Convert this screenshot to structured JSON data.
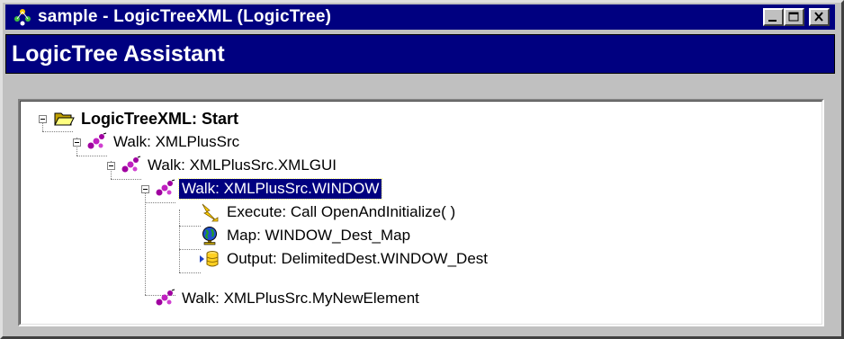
{
  "window": {
    "title": "sample - LogicTreeXML (LogicTree)",
    "controls": [
      "minimize",
      "maximize",
      "close"
    ]
  },
  "banner": {
    "title": "LogicTree Assistant"
  },
  "tree": {
    "nodes": [
      {
        "label": "LogicTreeXML: Start",
        "icon": "folder-open-icon",
        "bold": true
      },
      {
        "label": "Walk: XMLPlusSrc",
        "icon": "walk-icon"
      },
      {
        "label": "Walk: XMLPlusSrc.XMLGUI",
        "icon": "walk-icon"
      },
      {
        "label": "Walk: XMLPlusSrc.WINDOW",
        "icon": "walk-icon",
        "selected": true
      },
      {
        "label": "Execute: Call OpenAndInitialize( )",
        "icon": "lightning-icon"
      },
      {
        "label": "Map: WINDOW_Dest_Map",
        "icon": "globe-icon"
      },
      {
        "label": "Output: DelimitedDest.WINDOW_Dest",
        "icon": "database-output-icon"
      },
      {
        "label": "Walk: XMLPlusSrc.MyNewElement",
        "icon": "walk-icon"
      }
    ]
  },
  "colors": {
    "titlebar": "#000080",
    "selection": "#000080",
    "face": "#c0c0c0"
  }
}
